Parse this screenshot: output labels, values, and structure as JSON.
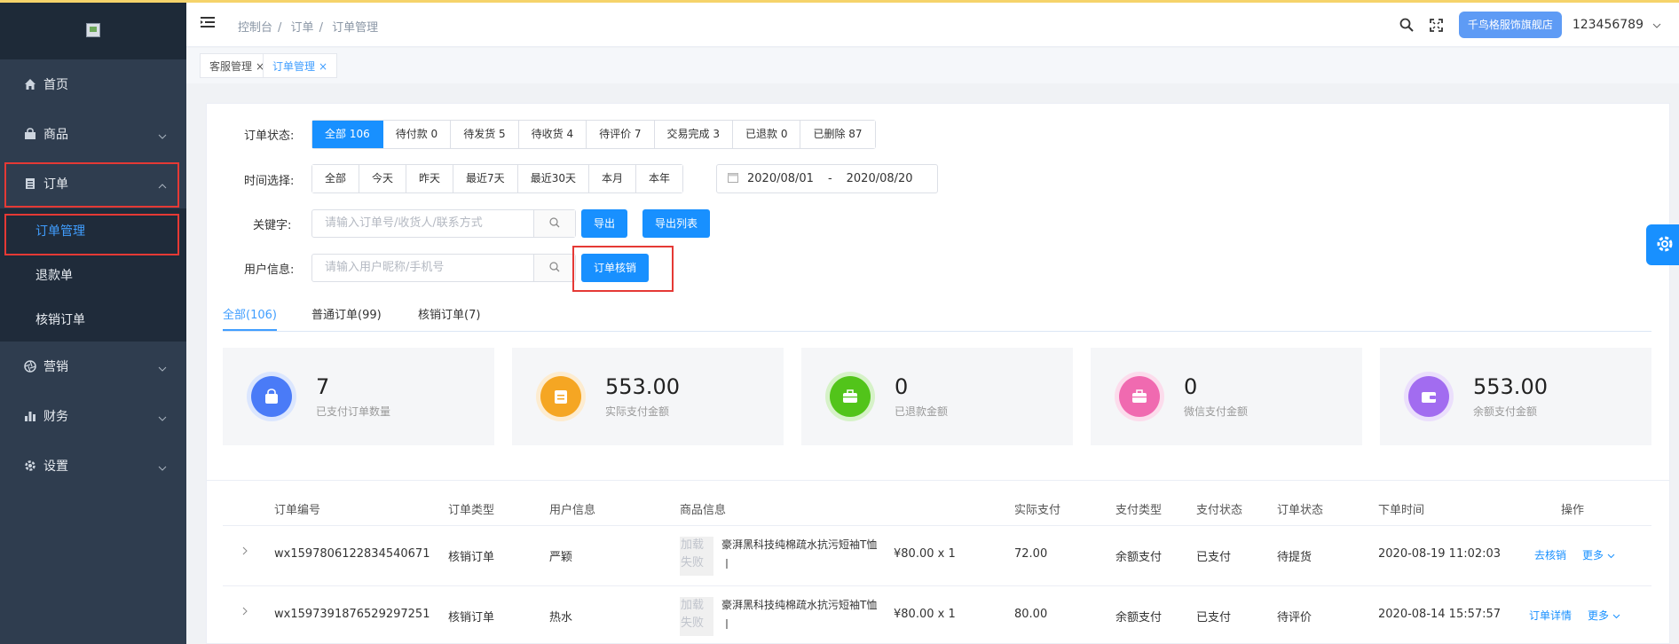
{
  "sidebar": {
    "items": [
      {
        "label": "首页",
        "icon": "home-icon"
      },
      {
        "label": "商品",
        "icon": "bag-icon"
      },
      {
        "label": "订单",
        "icon": "clipboard-icon"
      },
      {
        "label": "营销",
        "icon": "aperture-icon"
      },
      {
        "label": "财务",
        "icon": "bar-chart-icon"
      },
      {
        "label": "设置",
        "icon": "gear-icon"
      }
    ],
    "sub_items": [
      "订单管理",
      "退款单",
      "核销订单"
    ]
  },
  "header": {
    "breadcrumb": [
      "控制台",
      "订单",
      "订单管理"
    ],
    "shop_button": "千鸟格服饰旗舰店",
    "username": "123456789"
  },
  "tags": [
    {
      "label": "客服管理"
    },
    {
      "label": "订单管理"
    }
  ],
  "filters": {
    "status_label": "订单状态:",
    "status_options": [
      "全部 106",
      "待付款 0",
      "待发货 5",
      "待收货 4",
      "待评价 7",
      "交易完成 3",
      "已退款 0",
      "已删除 87"
    ],
    "time_label": "时间选择:",
    "time_options": [
      "全部",
      "今天",
      "昨天",
      "最近7天",
      "最近30天",
      "本月",
      "本年"
    ],
    "date_start": "2020/08/01",
    "date_sep": "-",
    "date_end": "2020/08/20",
    "keyword_label": "关键字:",
    "keyword_placeholder": "请输入订单号/收货人/联系方式",
    "export_label": "导出",
    "export_list_label": "导出列表",
    "user_label": "用户信息:",
    "user_placeholder": "请输入用户昵称/手机号",
    "verify_label": "订单核销"
  },
  "tabs": [
    "全部(106)",
    "普通订单(99)",
    "核销订单(7)"
  ],
  "stats": [
    {
      "value": "7",
      "label": "已支付订单数量",
      "color": "#4a7bf7",
      "icon": "shopping-bag-icon"
    },
    {
      "value": "553.00",
      "label": "实际支付金额",
      "color": "#f5a623",
      "icon": "clipboard-icon"
    },
    {
      "value": "0",
      "label": "已退款金额",
      "color": "#52c41a",
      "icon": "briefcase-icon"
    },
    {
      "value": "0",
      "label": "微信支付金额",
      "color": "#f06ab0",
      "icon": "briefcase-icon"
    },
    {
      "value": "553.00",
      "label": "余额支付金额",
      "color": "#a26cf0",
      "icon": "wallet-icon"
    }
  ],
  "table": {
    "headers": [
      "订单编号",
      "订单类型",
      "用户信息",
      "商品信息",
      "实际支付",
      "支付类型",
      "支付状态",
      "订单状态",
      "下单时间",
      "操作"
    ],
    "rows": [
      {
        "order_no": "wx1597806122834540671",
        "type": "核销订单",
        "user": "严颖",
        "thumb": "加载失败",
        "product": "豪湃黑科技纯棉疏水抗污短袖T恤丨",
        "price": "¥80.00 x 1",
        "paid": "72.00",
        "pay_type": "余额支付",
        "pay_status": "已支付",
        "status": "待提货",
        "time": "2020-08-19 11:02:03",
        "action": "去核销",
        "more": "更多"
      },
      {
        "order_no": "wx1597391876529297251",
        "type": "核销订单",
        "user": "热水",
        "thumb": "加载失败",
        "product": "豪湃黑科技纯棉疏水抗污短袖T恤丨",
        "price": "¥80.00 x 1",
        "paid": "80.00",
        "pay_type": "余额支付",
        "pay_status": "已支付",
        "status": "待评价",
        "time": "2020-08-14 15:57:57",
        "action": "订单详情",
        "more": "更多"
      }
    ]
  }
}
